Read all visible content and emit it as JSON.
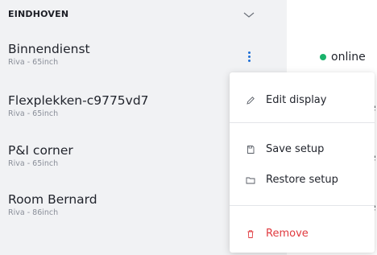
{
  "group": {
    "title": "EINDHOVEN"
  },
  "displays": [
    {
      "name": "Binnendienst",
      "model": "Riva - 65inch"
    },
    {
      "name": "Flexplekken-c9775vd7",
      "model": "Riva - 65inch"
    },
    {
      "name": "P&I corner",
      "model": "Riva - 65inch"
    },
    {
      "name": "Room Bernard",
      "model": "Riva - 86inch"
    }
  ],
  "status": {
    "label": "online",
    "peek": [
      "e",
      "e",
      "e"
    ],
    "dot_color": "#19b26b"
  },
  "menu": {
    "items": [
      {
        "label": "Edit display",
        "icon": "pencil-icon"
      },
      {
        "label": "Save setup",
        "icon": "save-icon"
      },
      {
        "label": "Restore setup",
        "icon": "folder-icon"
      },
      {
        "label": "Remove",
        "icon": "trash-icon"
      }
    ],
    "danger_color": "#e0393e",
    "accent_color": "#1e6fd6"
  }
}
